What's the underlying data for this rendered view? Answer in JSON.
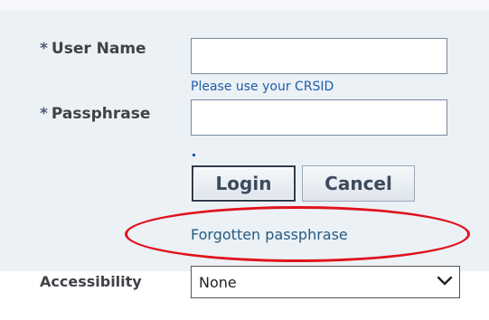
{
  "login_form": {
    "username": {
      "required_marker": "*",
      "label": "User Name",
      "value": "",
      "hint": "Please use your CRSID"
    },
    "passphrase": {
      "required_marker": "*",
      "label": "Passphrase",
      "value": ""
    },
    "buttons": {
      "login_label": "Login",
      "cancel_label": "Cancel"
    },
    "forgotten_link": "Forgotten passphrase"
  },
  "accessibility": {
    "label": "Accessibility",
    "selected": "None"
  },
  "annotation": {
    "highlight_color": "#e0121c"
  }
}
